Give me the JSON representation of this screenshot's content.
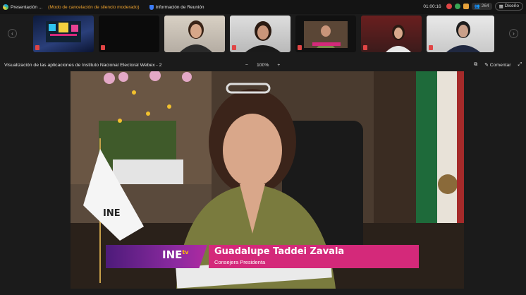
{
  "topbar": {
    "app_label": "Presentación ...",
    "noise_mode": "(Modo de cancelación de silencio moderado)",
    "meeting_info": "Información de Reunión",
    "timer": "01:00:16",
    "participants_count": "264",
    "layout_label": "Diseño"
  },
  "share": {
    "window_title": "Visualización de las aplicaciones de Instituto Nacional Electoral Webex - 2",
    "zoom_level": "100%",
    "zoom_minus": "−",
    "zoom_plus": "+",
    "comment_label": "Comentar"
  },
  "video": {
    "speaker_name": "Guadalupe Taddei Zavala",
    "speaker_role": "Consejera Presidenta",
    "logo_text": "INE",
    "logo_suffix": "tv",
    "flag_logo": "INE"
  },
  "colors": {
    "accent_pink": "#d4297a",
    "accent_purple": "#8d2aa0",
    "warning_orange": "#f0a42f"
  }
}
